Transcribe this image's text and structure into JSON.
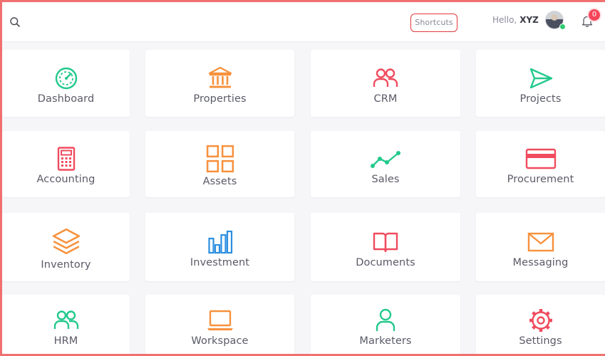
{
  "header": {
    "shortcuts_label": "Shortcuts",
    "greeting": "Hello,",
    "username": "XYZ",
    "notification_count": "0"
  },
  "colors": {
    "green": "#22c98c",
    "orange": "#f7913d",
    "red": "#f04b5e",
    "blue": "#2b8ee0"
  },
  "modules": [
    {
      "label": "Dashboard",
      "icon": "dashboard-gauge-icon"
    },
    {
      "label": "Properties",
      "icon": "bank-building-icon"
    },
    {
      "label": "CRM",
      "icon": "users-icon"
    },
    {
      "label": "Projects",
      "icon": "send-paper-plane-icon"
    },
    {
      "label": "Accounting",
      "icon": "calculator-icon"
    },
    {
      "label": "Assets",
      "icon": "grid-squares-icon"
    },
    {
      "label": "Sales",
      "icon": "trend-line-icon"
    },
    {
      "label": "Procurement",
      "icon": "credit-card-icon"
    },
    {
      "label": "Inventory",
      "icon": "layers-icon"
    },
    {
      "label": "Investment",
      "icon": "bar-chart-icon"
    },
    {
      "label": "Documents",
      "icon": "open-book-icon"
    },
    {
      "label": "Messaging",
      "icon": "mail-icon"
    },
    {
      "label": "HRM",
      "icon": "users-icon"
    },
    {
      "label": "Workspace",
      "icon": "laptop-icon"
    },
    {
      "label": "Marketers",
      "icon": "user-icon"
    },
    {
      "label": "Settings",
      "icon": "gear-icon"
    }
  ]
}
